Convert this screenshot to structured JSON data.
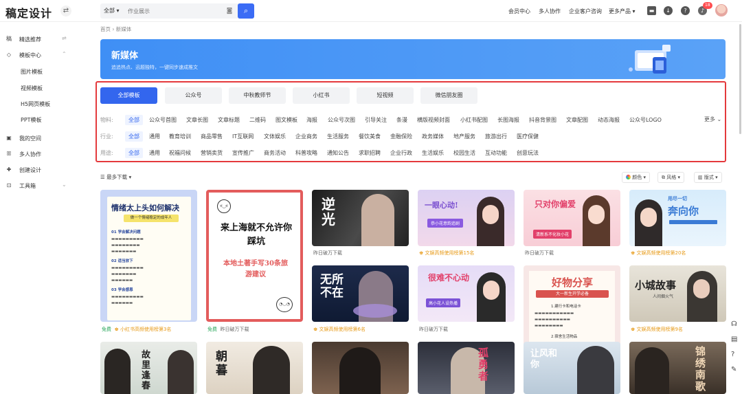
{
  "header": {
    "logo": "稿定设计",
    "search_category": "全部",
    "search_placeholder": "作业展示",
    "nav": [
      "会员中心",
      "多人协作",
      "企业客户咨询",
      "更多产品"
    ],
    "notification_count": "18"
  },
  "sidebar": {
    "items": [
      {
        "label": "精选推荐",
        "icon": "recommend-icon"
      },
      {
        "label": "模板中心",
        "icon": "template-icon"
      },
      {
        "label": "我的空间",
        "icon": "space-icon"
      },
      {
        "label": "多人协作",
        "icon": "team-icon"
      },
      {
        "label": "创建设计",
        "icon": "create-icon"
      },
      {
        "label": "工具箱",
        "icon": "toolbox-icon"
      }
    ],
    "sub_items": [
      "图片模板",
      "视频模板",
      "H5网页模板",
      "PPT模板"
    ]
  },
  "breadcrumb": "首页 › 新媒体",
  "banner": {
    "title": "新媒体",
    "subtitle": "追追热点、迅题独特，一键同步速成推文"
  },
  "tabs": [
    "全部模板",
    "公众号",
    "中秋教师节",
    "小红书",
    "短视频",
    "微信朋友圈"
  ],
  "filters": {
    "material": {
      "label": "物料:",
      "items": [
        "全部",
        "公众号首图",
        "文章长图",
        "文章标题",
        "二维码",
        "图文模板",
        "海报",
        "公众号次图",
        "引导关注",
        "条漫",
        "横版视频封面",
        "小红书配图",
        "长图海报",
        "抖音背景图",
        "文章配图",
        "动态海报",
        "公众号LOGO"
      ]
    },
    "industry": {
      "label": "行业:",
      "items": [
        "全部",
        "通用",
        "教育培训",
        "商品零售",
        "IT互联网",
        "文体娱乐",
        "企业商务",
        "生活服务",
        "餐饮美食",
        "金融保险",
        "政务媒体",
        "地产服务",
        "旅游出行",
        "医疗保健"
      ]
    },
    "usage": {
      "label": "用途:",
      "items": [
        "全部",
        "通用",
        "祝福问候",
        "营销卖货",
        "宣传推广",
        "商务活动",
        "科普攻略",
        "通知公告",
        "求职招聘",
        "企业行政",
        "生活娱乐",
        "校园生活",
        "互动功能",
        "创意玩法"
      ]
    },
    "more": "更多"
  },
  "toolbar": {
    "sort": "最多下载",
    "color": "颜色",
    "style": "风格",
    "layout": "版式"
  },
  "cards": [
    {
      "title": "情绪太上头如何解决",
      "subtitle": "做一个情绪稳定的成年人",
      "caption_free": "免费",
      "caption_rank": "小红书高频使用榜第3名",
      "para": [
        "01 学会解决问题",
        "01 学会接纳情绪",
        "02 适当放下",
        "03 学会感恩"
      ]
    },
    {
      "title": "来上海就不允许你踩坑",
      "subtitle": "本地土著手写30条旅游建议",
      "caption_free": "免费",
      "caption_rank": "昨日破万下载"
    },
    {
      "title": "逆光",
      "caption_rank": "昨日破万下载"
    },
    {
      "title": "一眼心动!",
      "subtitle": "恭小花意韵追剧",
      "caption_rank": "文娱高频使用榜第15名"
    },
    {
      "title": "只对你偏爱",
      "subtitle": "清新系不化妆小花",
      "caption_rank": "昨日破万下载"
    },
    {
      "title": "奔向你",
      "subtitle": "用尽一切",
      "caption_rank": "文娱高频使用榜第20名"
    },
    {
      "title": "无所不在",
      "caption_rank": "文娱高频使用榜第6名"
    },
    {
      "title": "很难不心动",
      "subtitle": "高小花人设热播",
      "caption_rank": "昨日破万下载"
    },
    {
      "title": "好物分享",
      "subtitle": "大一新生开学必备",
      "para": [
        "1.建行卡和电话卡",
        "2.宿舍生活物品"
      ]
    },
    {
      "title": "小城故事",
      "subtitle": "人间烟火气",
      "caption_rank": "文娱高频使用榜第9名"
    },
    {
      "title": "故里逢春"
    },
    {
      "title": "朝暮"
    },
    {
      "title": ""
    },
    {
      "title": "孤勇者"
    },
    {
      "title": "让风和你"
    },
    {
      "title": "锦绣南歌"
    }
  ],
  "colors": {
    "accent": "#3366ee",
    "highlight_border": "#e4393c",
    "banner": "#4a95f6"
  }
}
